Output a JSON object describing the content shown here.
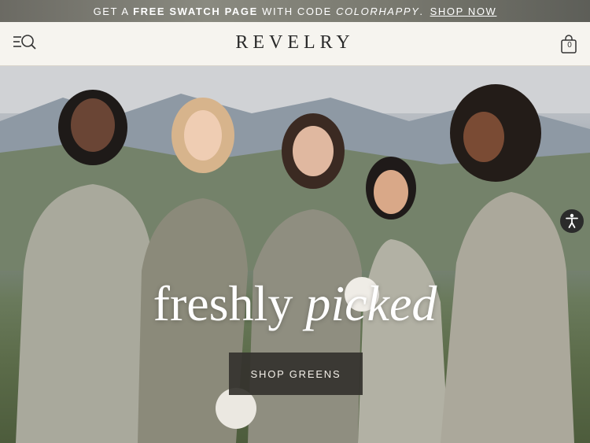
{
  "promo": {
    "prefix": "GET A ",
    "highlight": "FREE SWATCH PAGE",
    "middle": " WITH CODE ",
    "code": "COLORHAPPY",
    "suffix": ".",
    "link": "SHOP NOW"
  },
  "header": {
    "logo": "REVELRY",
    "cart_count": "0",
    "menu_icon": "menu-search-icon",
    "cart_icon": "shopping-bag-icon"
  },
  "hero": {
    "headline_regular": "freshly ",
    "headline_italic": "picked",
    "cta_label": "SHOP GREENS",
    "accessibility_icon": "accessibility-icon"
  },
  "colors": {
    "banner": "#6f6f66",
    "header_bg": "#f6f4ef",
    "cta_bg": "#34322e",
    "text_dark": "#2a2a2a"
  }
}
